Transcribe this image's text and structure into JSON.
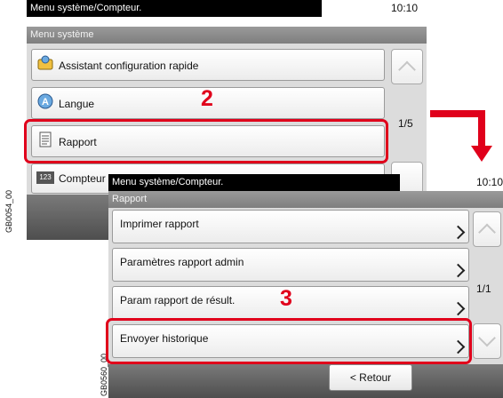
{
  "screen1": {
    "title": "Menu système/Compteur.",
    "clock": "10:10",
    "subtitle": "Menu système",
    "items": [
      {
        "label": "Assistant configuration rapide",
        "icon": "wizard-icon"
      },
      {
        "label": "Langue",
        "icon": "language-icon"
      },
      {
        "label": "Rapport",
        "icon": "report-icon"
      },
      {
        "label": "Compteur",
        "icon": "counter-icon"
      }
    ],
    "page": "1/5",
    "counter_icon_text": "123",
    "side_label": "GB0054_00"
  },
  "screen2": {
    "title": "Menu système/Compteur.",
    "clock": "10:10",
    "subtitle": "Rapport",
    "items": [
      {
        "label": "Imprimer rapport"
      },
      {
        "label": "Paramètres rapport admin"
      },
      {
        "label": "Param rapport de résult."
      },
      {
        "label": "Envoyer historique"
      }
    ],
    "page": "1/1",
    "back_label": "< Retour",
    "side_label": "GB0560_00"
  },
  "steps": [
    "2",
    "3"
  ],
  "colors": {
    "highlight": "#e0001b",
    "title_bar": "#000000",
    "sub_bar": "#8a8a8a"
  }
}
